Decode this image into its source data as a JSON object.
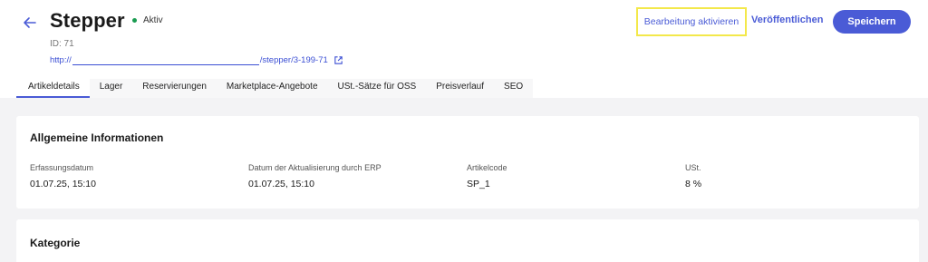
{
  "header": {
    "title": "Stepper",
    "status": {
      "label": "Aktiv",
      "color": "#1a9b50"
    },
    "id_text": "ID: 71",
    "url": {
      "prefix": "http://",
      "suffix": "/stepper/3-199-71"
    },
    "back_icon": "arrow-left-icon",
    "external_icon": "external-link-icon"
  },
  "actions": {
    "edit_label": "Bearbeitung aktivieren",
    "publish_label": "Veröffentlichen",
    "save_label": "Speichern"
  },
  "colors": {
    "accent": "#4a5bd6",
    "highlight": "#f3e84a",
    "background": "#f3f3f5"
  },
  "tabs": [
    {
      "label": "Artikeldetails",
      "active": true
    },
    {
      "label": "Lager",
      "active": false
    },
    {
      "label": "Reservierungen",
      "active": false
    },
    {
      "label": "Marketplace-Angebote",
      "active": false
    },
    {
      "label": "USt.-Sätze für OSS",
      "active": false
    },
    {
      "label": "Preisverlauf",
      "active": false
    },
    {
      "label": "SEO",
      "active": false
    }
  ],
  "general_info": {
    "title": "Allgemeine Informationen",
    "fields": [
      {
        "label": "Erfassungsdatum",
        "value": "01.07.25, 15:10"
      },
      {
        "label": "Datum der Aktualisierung durch ERP",
        "value": "01.07.25, 15:10"
      },
      {
        "label": "Artikelcode",
        "value": "SP_1"
      },
      {
        "label": "USt.",
        "value": "8 %"
      }
    ]
  },
  "category": {
    "title": "Kategorie"
  }
}
